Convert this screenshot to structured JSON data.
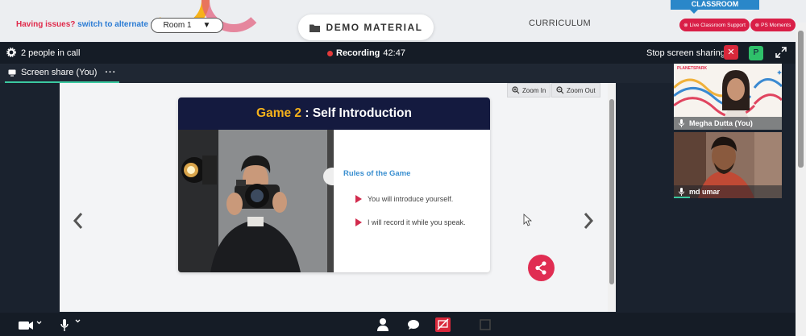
{
  "topbar": {
    "issues_text": "Having issues?",
    "switch_link": "switch to alternate room",
    "room_select": {
      "value": "Room 1",
      "arrow": "▼"
    },
    "demo_material_label": "DEMO MATERIAL",
    "curriculum_label": "CURRICULUM",
    "classroom_tab": "CLASSROOM",
    "live_support_label": "Live Classroom Support",
    "ps_moments_label": "PS Moments"
  },
  "call": {
    "people_count": "2 people in call",
    "recording_label": "Recording",
    "recording_time": "42:47",
    "stop_sharing_label": "Stop screen sharing",
    "stop_x": "✕",
    "participant_badge": "P"
  },
  "share_tab": {
    "label": "Screen share (You)",
    "menu": "···"
  },
  "slide": {
    "zoom_in": "Zoom In",
    "zoom_out": "Zoom Out",
    "title_accent": "Game 2",
    "title_rest": " : Self Introduction",
    "rules_title": "Rules of the Game",
    "rules": [
      "You will introduce yourself.",
      "I will record it while you speak."
    ]
  },
  "participants": [
    {
      "name": "Megha Dutta (You)",
      "logo": "PLANETSPARK"
    },
    {
      "name": "md umar"
    }
  ],
  "colors": {
    "accent_red": "#e02d52",
    "title_yellow": "#f6b21b",
    "navy": "#141a3f",
    "teal": "#3bc9a0"
  }
}
